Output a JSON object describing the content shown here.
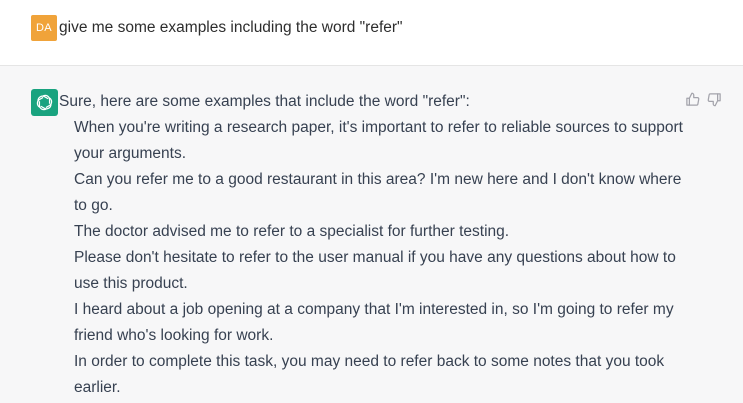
{
  "colors": {
    "user_avatar_bg": "#f0a33a",
    "assistant_avatar_bg": "#19a37f",
    "assistant_row_bg": "#f7f7f8",
    "icon_gray": "#a3a3ab"
  },
  "user_message": {
    "avatar_initials": "DA",
    "text": "give me some examples including the word \"refer\""
  },
  "assistant_message": {
    "avatar_icon": "openai-logo-icon",
    "intro": "Sure, here are some examples that include the word \"refer\":",
    "examples": [
      "When you're writing a research paper, it's important to refer to reliable sources to support your arguments.",
      "Can you refer me to a good restaurant in this area? I'm new here and I don't know where to go.",
      "The doctor advised me to refer to a specialist for further testing.",
      "Please don't hesitate to refer to the user manual if you have any questions about how to use this product.",
      "I heard about a job opening at a company that I'm interested in, so I'm going to refer my friend who's looking for work.",
      "In order to complete this task, you may need to refer back to some notes that you took earlier."
    ]
  },
  "feedback": {
    "like_icon": "thumbs-up-icon",
    "dislike_icon": "thumbs-down-icon"
  }
}
